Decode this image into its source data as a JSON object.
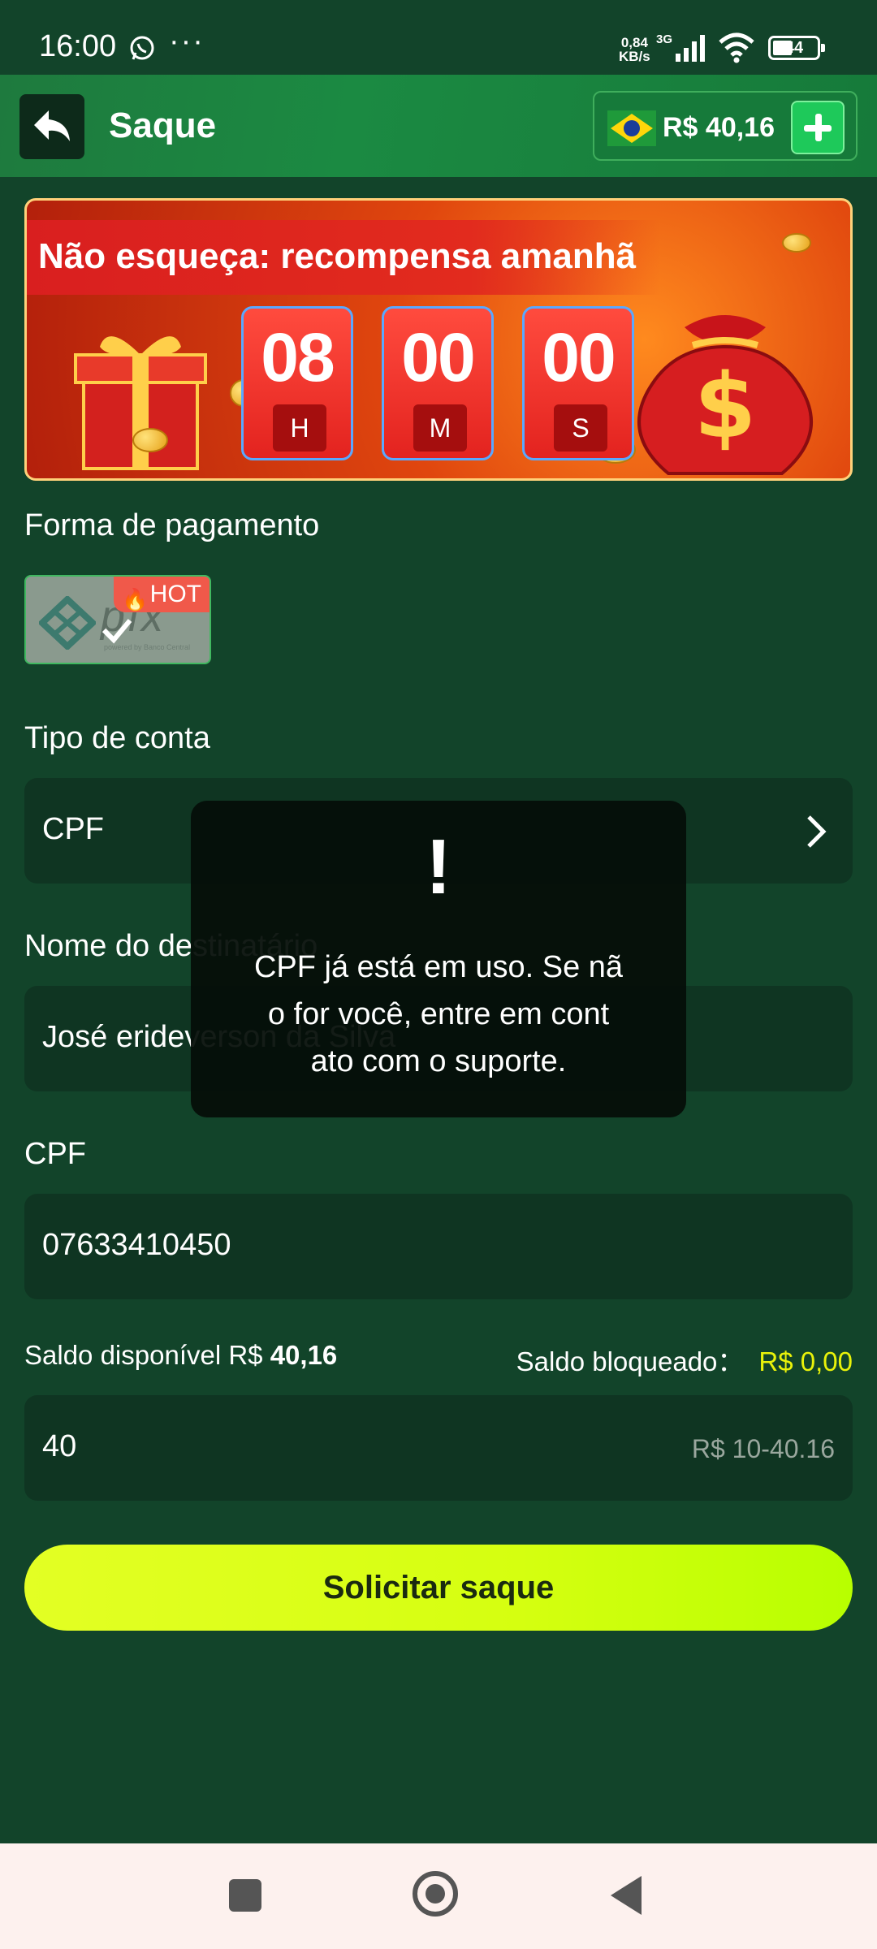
{
  "status_bar": {
    "time": "16:00",
    "speed_value": "0,84",
    "speed_unit": "KB/s",
    "network": "3G",
    "battery": "44"
  },
  "header": {
    "title": "Saque",
    "balance": "R$ 40,16"
  },
  "banner": {
    "title": "Não esqueça: recompensa amanhã",
    "timer": [
      {
        "value": "08",
        "unit": "H"
      },
      {
        "value": "00",
        "unit": "M"
      },
      {
        "value": "00",
        "unit": "S"
      }
    ]
  },
  "payment": {
    "label": "Forma de pagamento",
    "method_name": "pix",
    "method_sub": "powered by Banco Central",
    "badge": "HOT"
  },
  "account_type": {
    "label": "Tipo de conta",
    "value": "CPF"
  },
  "recipient": {
    "label": "Nome do destinatário",
    "value": "José erideverson da Silva"
  },
  "cpf": {
    "label": "CPF",
    "value": "07633410450"
  },
  "saldo": {
    "available_label": "Saldo disponível R$",
    "available_value": "40,16",
    "blocked_label": "Saldo bloqueado：",
    "blocked_value": "R$ 0,00"
  },
  "amount": {
    "value": "40",
    "hint": "R$ 10-40.16"
  },
  "submit_label": "Solicitar saque",
  "toast": {
    "icon": "!",
    "line1": "CPF já está em uso. Se nã",
    "line2": "o for você, entre em cont",
    "line3": "ato com o suporte."
  },
  "colors": {
    "background": "#12442a",
    "header": "#1b8a42",
    "field": "#0f3522",
    "accent_yellow": "#e9f20a",
    "button": "#d5ff10"
  }
}
